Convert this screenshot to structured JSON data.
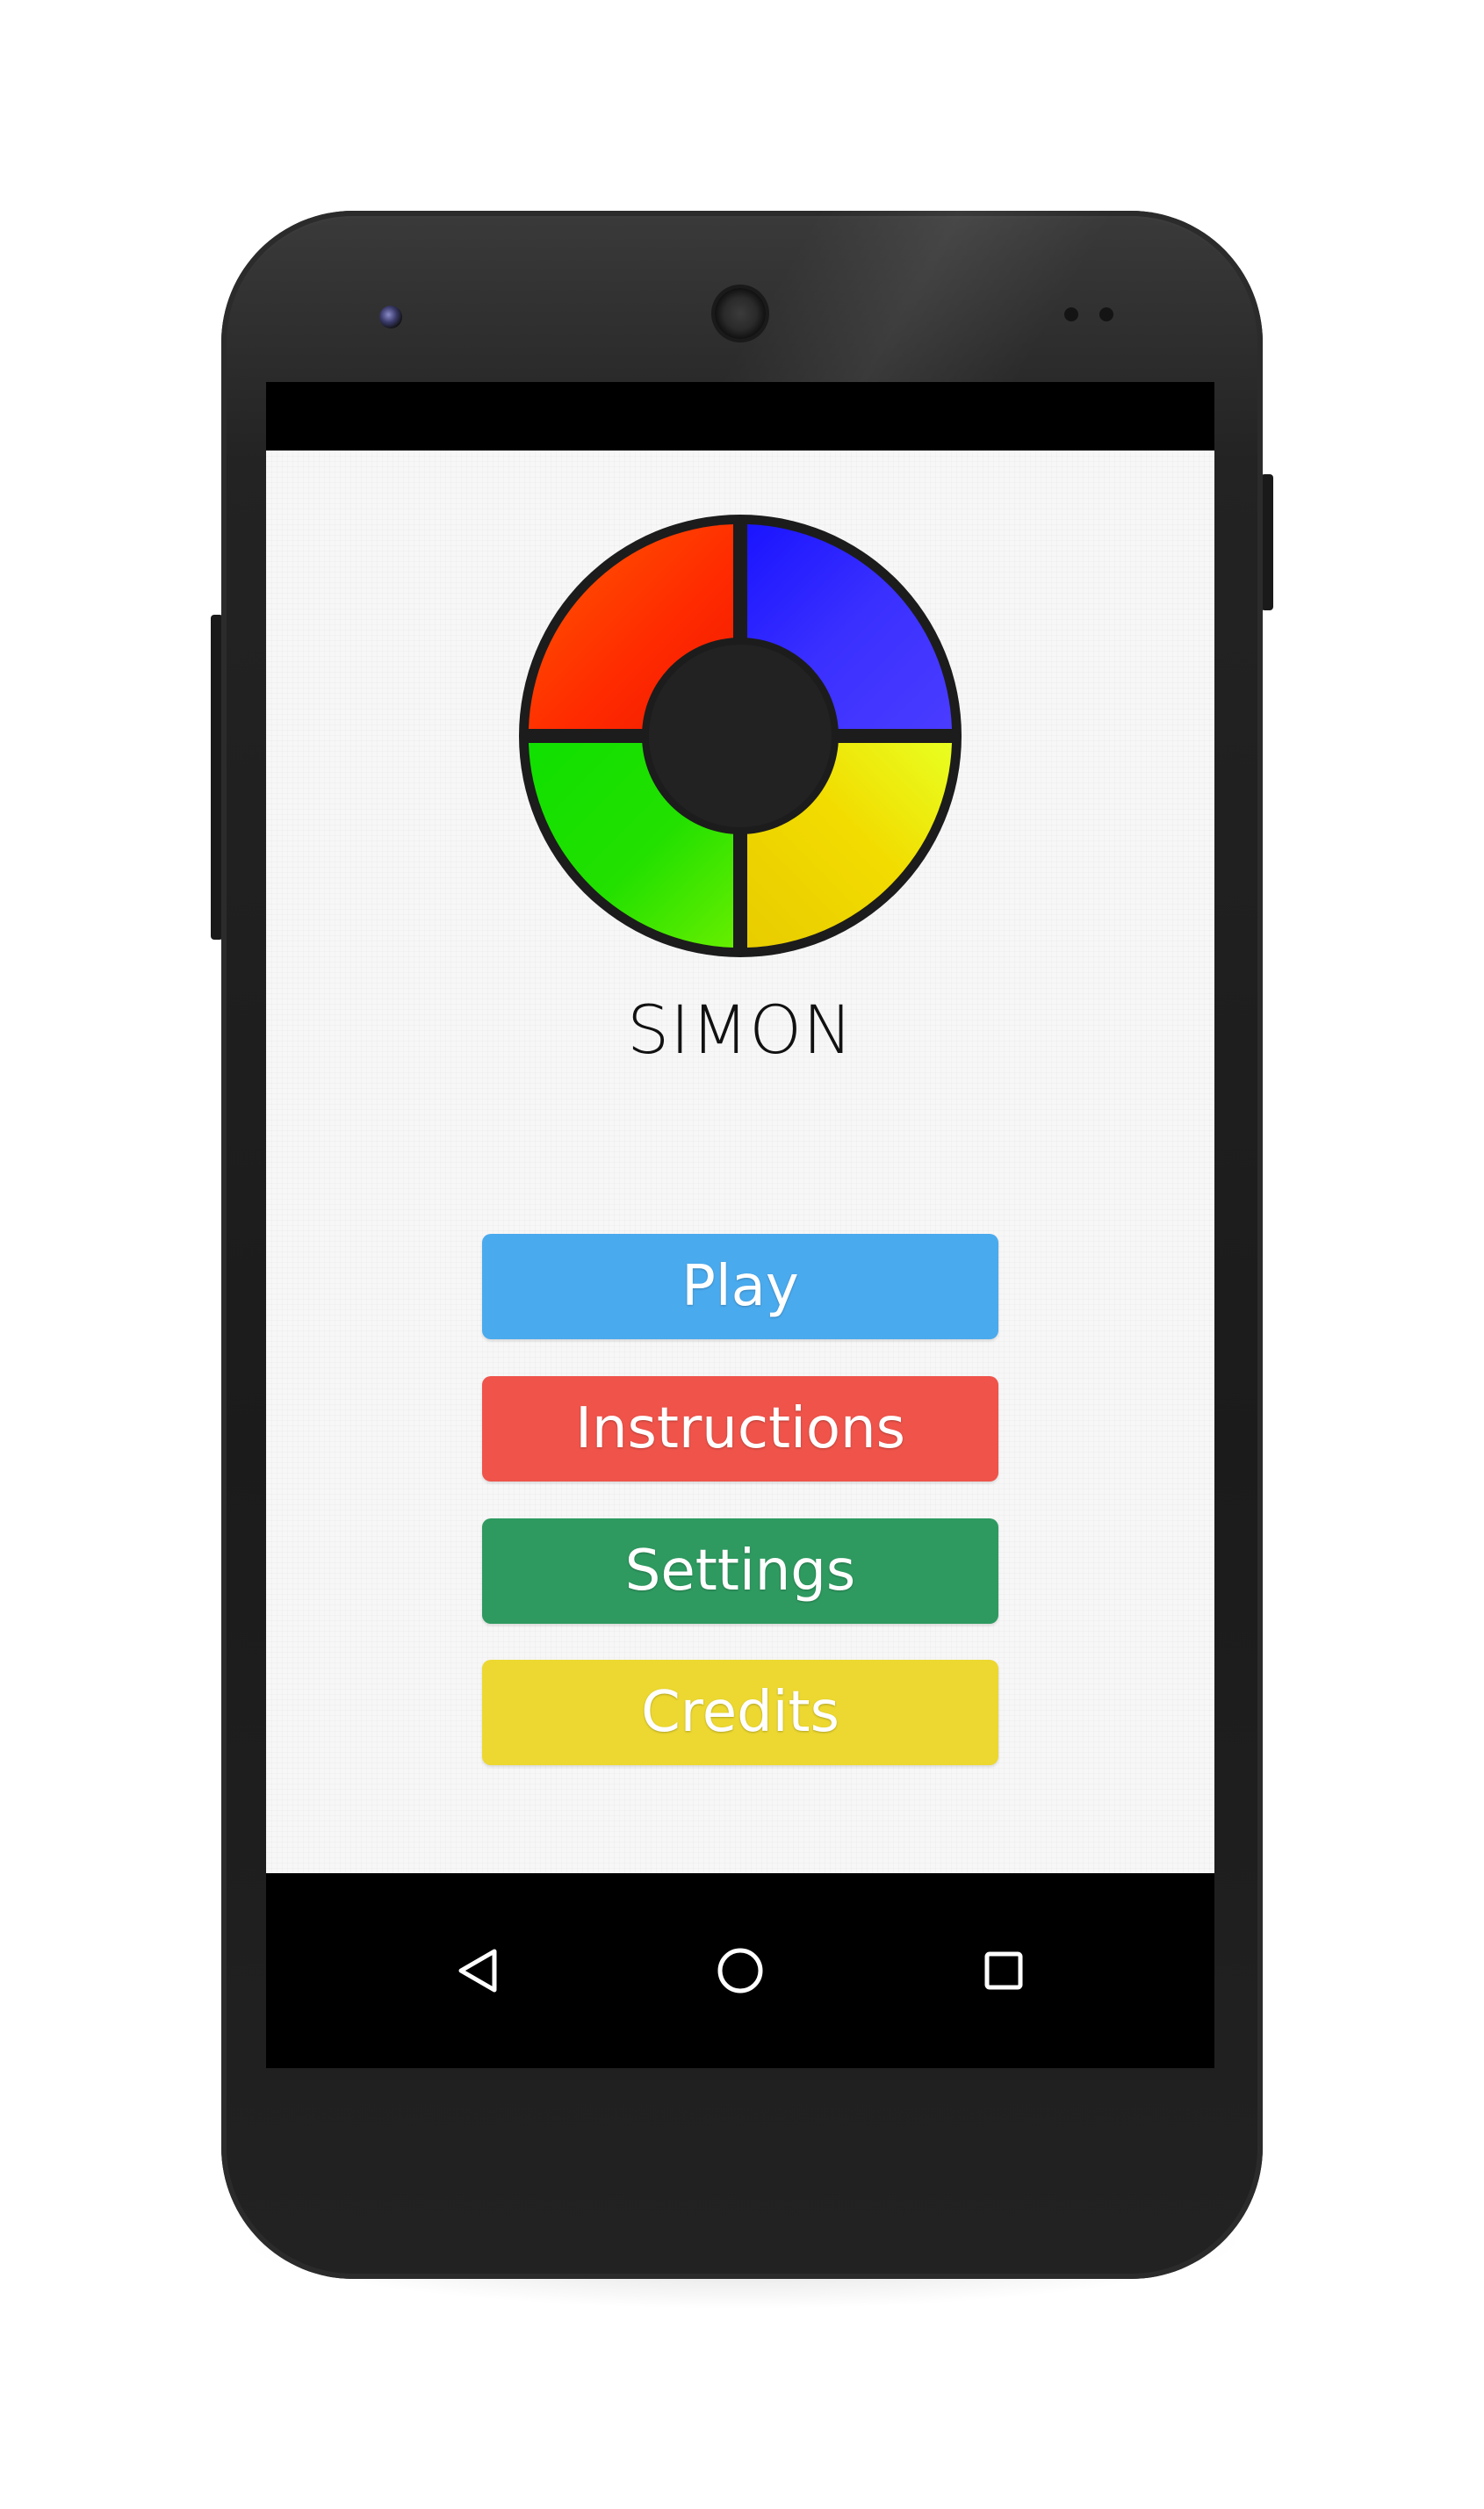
{
  "app": {
    "title": "SIMON",
    "logo": {
      "quadrants": [
        {
          "name": "red",
          "color": "#ff2a00"
        },
        {
          "name": "blue",
          "color": "#4a3cff"
        },
        {
          "name": "green",
          "color": "#22e000"
        },
        {
          "name": "yellow",
          "color": "#f2dc00"
        }
      ],
      "center_color": "#222222",
      "ring_color": "#1c1c1c"
    }
  },
  "menu": {
    "buttons": [
      {
        "id": "play",
        "label": "Play",
        "color": "#4aaaee"
      },
      {
        "id": "instructions",
        "label": "Instructions",
        "color": "#ef534a"
      },
      {
        "id": "settings",
        "label": "Settings",
        "color": "#2e9a60"
      },
      {
        "id": "credits",
        "label": "Credits",
        "color": "#ecd830"
      }
    ]
  },
  "navigation": {
    "keys": [
      {
        "id": "back",
        "icon": "back-triangle-icon"
      },
      {
        "id": "home",
        "icon": "home-circle-icon"
      },
      {
        "id": "recents",
        "icon": "recents-square-icon"
      }
    ],
    "icon_color": "#ffffff"
  }
}
